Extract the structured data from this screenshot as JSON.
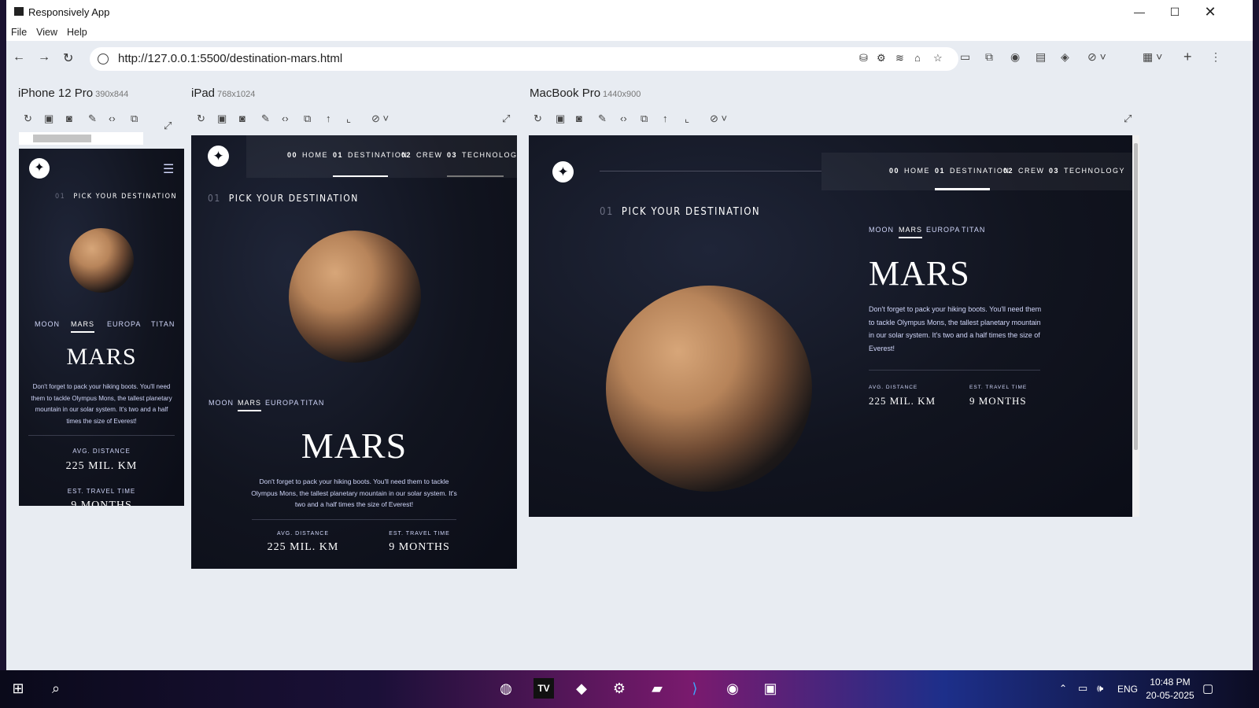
{
  "window": {
    "title": "Responsively App"
  },
  "menu": [
    "File",
    "View",
    "Help"
  ],
  "address": {
    "url": "http://127.0.0.1:5500/destination-mars.html"
  },
  "devices": [
    {
      "name": "iPhone 12 Pro",
      "size": "390x844"
    },
    {
      "name": "iPad",
      "size": "768x1024"
    },
    {
      "name": "MacBook Pro",
      "size": "1440x900"
    }
  ],
  "site": {
    "nav": [
      {
        "num": "00",
        "label": "HOME"
      },
      {
        "num": "01",
        "label": "DESTINATION"
      },
      {
        "num": "02",
        "label": "CREW"
      },
      {
        "num": "03",
        "label": "TECHNOLOGY"
      }
    ],
    "pick_num": "01",
    "pick_label": "PICK YOUR DESTINATION",
    "tabs": [
      "MOON",
      "MARS",
      "EUROPA",
      "TITAN"
    ],
    "active_tab": "MARS",
    "planet_name": "MARS",
    "description": "Don't forget to pack your hiking boots. You'll need them to tackle Olympus Mons, the tallest planetary mountain in our solar system. It's two and a half times the size of Everest!",
    "distance_label": "AVG. DISTANCE",
    "distance_value": "225 MIL. KM",
    "travel_label": "EST. TRAVEL TIME",
    "travel_value": "9 MONTHS",
    "travel_value_partial": "9 MONTHS"
  },
  "taskbar": {
    "lang": "ENG",
    "time": "10:48 PM",
    "date": "20-05-2025"
  }
}
